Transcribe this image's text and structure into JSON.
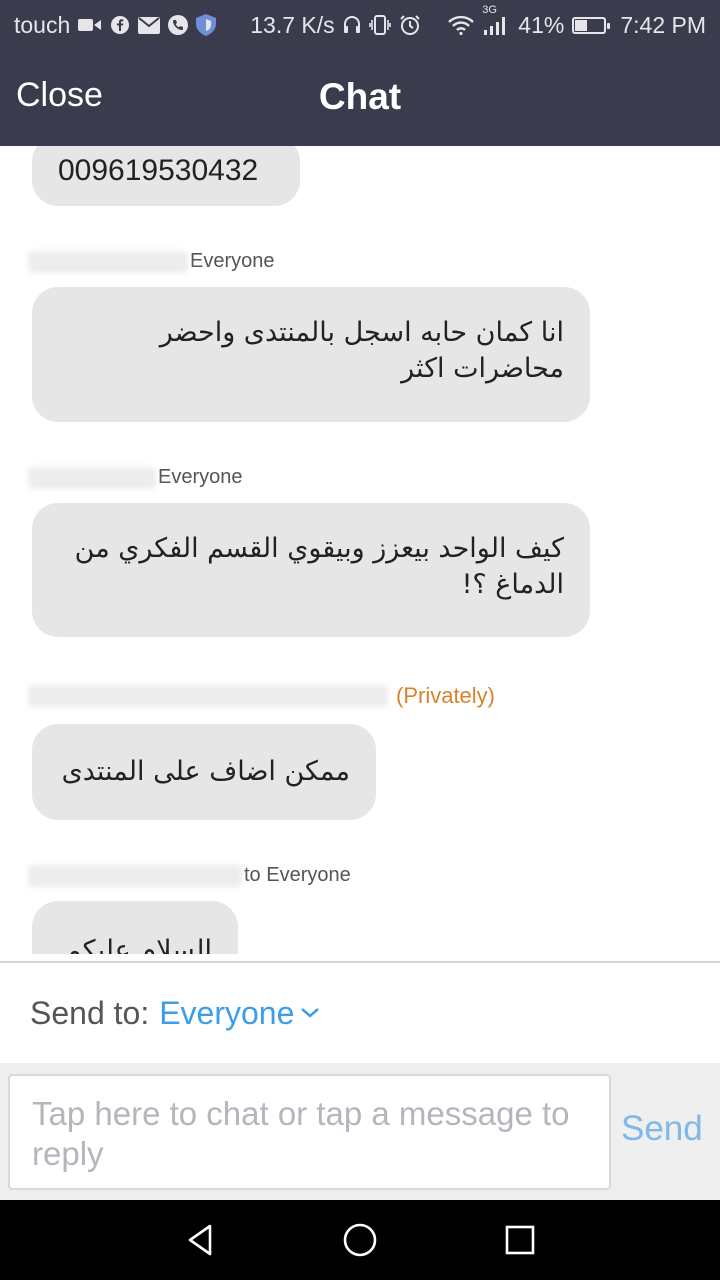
{
  "status_bar": {
    "carrier": "touch",
    "speed": "13.7 K/s",
    "network": "3G",
    "battery": "41%",
    "battery_level": 0.41,
    "time": "7:42 PM"
  },
  "header": {
    "close_label": "Close",
    "title": "Chat"
  },
  "messages": [
    {
      "recipient": "",
      "text": "009619530432"
    },
    {
      "recipient": "Everyone",
      "text": "انا كمان حابه اسجل بالمنتدى واحضر محاضرات اكثر"
    },
    {
      "recipient": "Everyone",
      "text": "كيف الواحد بيعزز وبيقوي القسم الفكري من الدماغ ؟!"
    },
    {
      "recipient": "(Privately)",
      "text": "ممكن  اضاف على المنتدى"
    },
    {
      "recipient": "to Everyone",
      "text": "السلام عليكم"
    }
  ],
  "send_to": {
    "label": "Send to:",
    "value": "Everyone"
  },
  "composer": {
    "placeholder": "Tap here to chat or tap a message to reply",
    "send_label": "Send"
  },
  "colors": {
    "header_bg": "#3a3c4d",
    "bubble_bg": "#e6e6e6",
    "accent": "#3d9ee8",
    "private": "#d9822b"
  }
}
